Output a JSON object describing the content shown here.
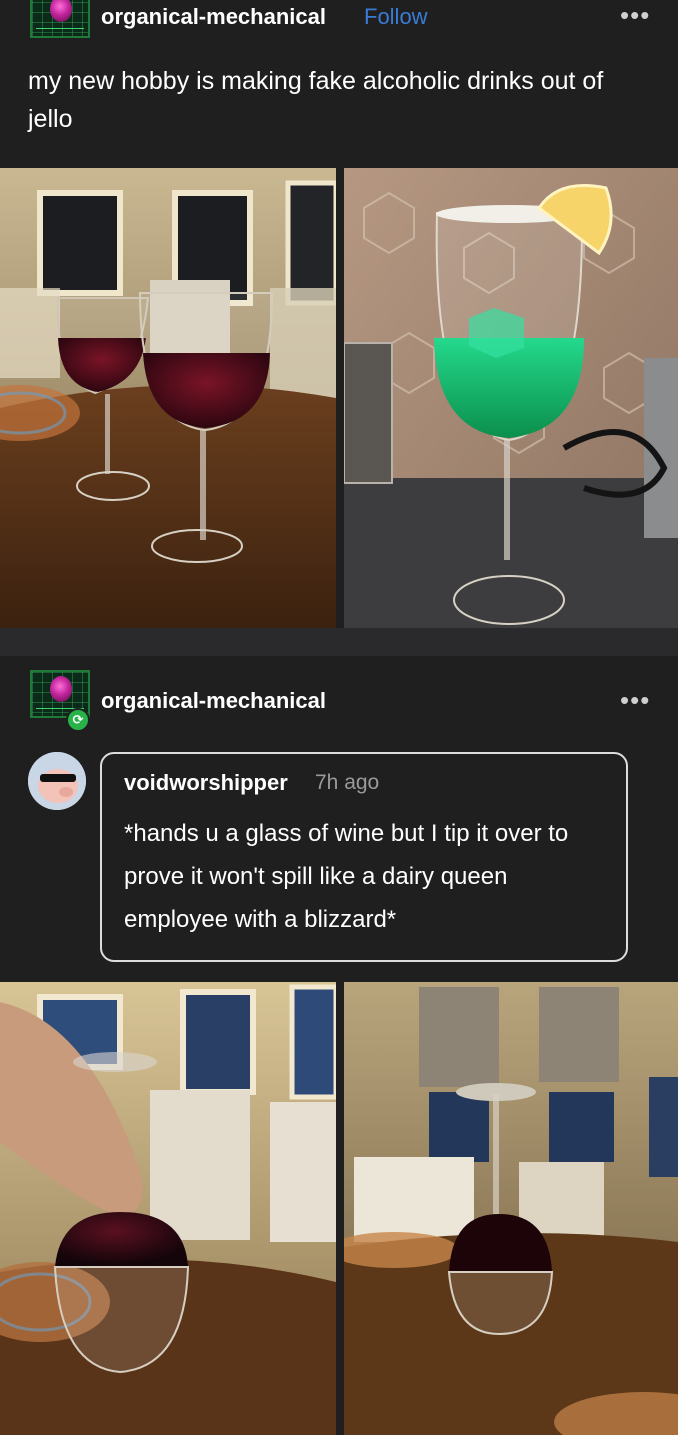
{
  "post": {
    "username": "organical-mechanical",
    "follow_label": "Follow",
    "more_label": "•••",
    "caption": "my new hobby is making fake alcoholic drinks out of jello"
  },
  "reblog": {
    "username": "organical-mechanical",
    "more_label": "•••",
    "reblog_icon": "reblog-icon"
  },
  "reply": {
    "username": "voidworshipper",
    "time": "7h ago",
    "text": "*hands u a glass of wine but I tip it over to prove it won't spill like a dairy queen employee with a blizzard*"
  },
  "colors": {
    "background": "#1f1f20",
    "follow_accent": "#3a7bd5",
    "reblog_green": "#27b34a"
  }
}
